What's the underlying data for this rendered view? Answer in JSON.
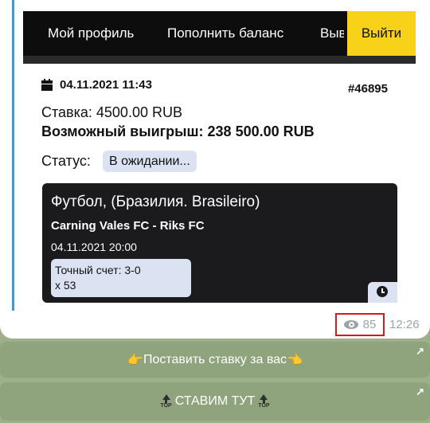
{
  "nav": {
    "profile": "Мой профиль",
    "topup": "Пополнить баланс",
    "out_partial": "Выв",
    "logout": "Выйти"
  },
  "bet": {
    "datetime": "04.11.2021 11:43",
    "id": "#46895",
    "stake": "Ставка: 4500.00 RUB",
    "payout": "Возможный выигрыш: 238 500.00 RUB",
    "status_label": "Статус:",
    "status_value": "В ожидании..."
  },
  "event": {
    "league": "Футбол, (Бразилия. Brasileiro)",
    "teams": "Carning Vales FC - Riks FC",
    "time": "04.11.2021 20:00",
    "pick_line1": "Точный счет: 3-0",
    "pick_line2": "x 53"
  },
  "message": {
    "views": "85",
    "time": "12:26"
  },
  "buttons": {
    "place_bet": "Поставить ставку за вас",
    "bet_here": "СТАВИМ ТУТ",
    "top_label": "TOP",
    "hand_left": "👉",
    "hand_right": "👈",
    "open_arrow": "↗"
  },
  "colors": {
    "accent": "#3a9bd8",
    "logout_yellow": "#f7d218",
    "highlight_red": "#d61b1b",
    "chat_green": "#9db08a"
  }
}
